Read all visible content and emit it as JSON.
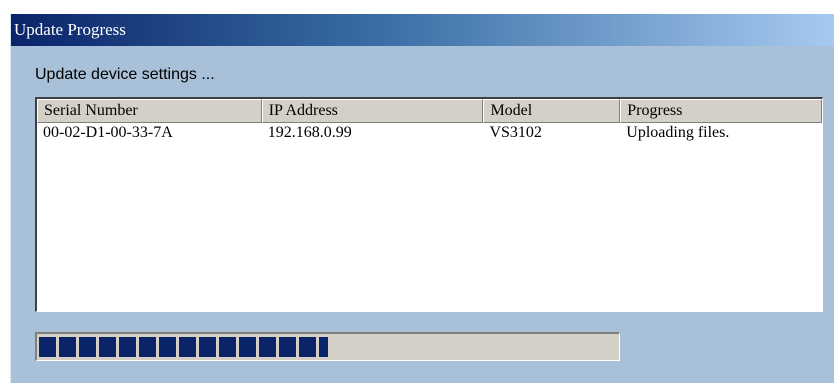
{
  "window": {
    "title": "Update Progress"
  },
  "status_text": "Update device settings ...",
  "list": {
    "columns": [
      "Serial Number",
      "IP Address",
      "Model",
      "Progress"
    ],
    "rows": [
      [
        "00-02-D1-00-33-7A",
        "192.168.0.99",
        "VS3102",
        "Uploading files."
      ]
    ]
  },
  "progress": {
    "fraction": 0.5
  },
  "colors": {
    "title_start": "#0a246a",
    "title_end": "#a6caf0",
    "progress_block": "#0a246a",
    "dialog_bg": "#a8c0d8"
  }
}
